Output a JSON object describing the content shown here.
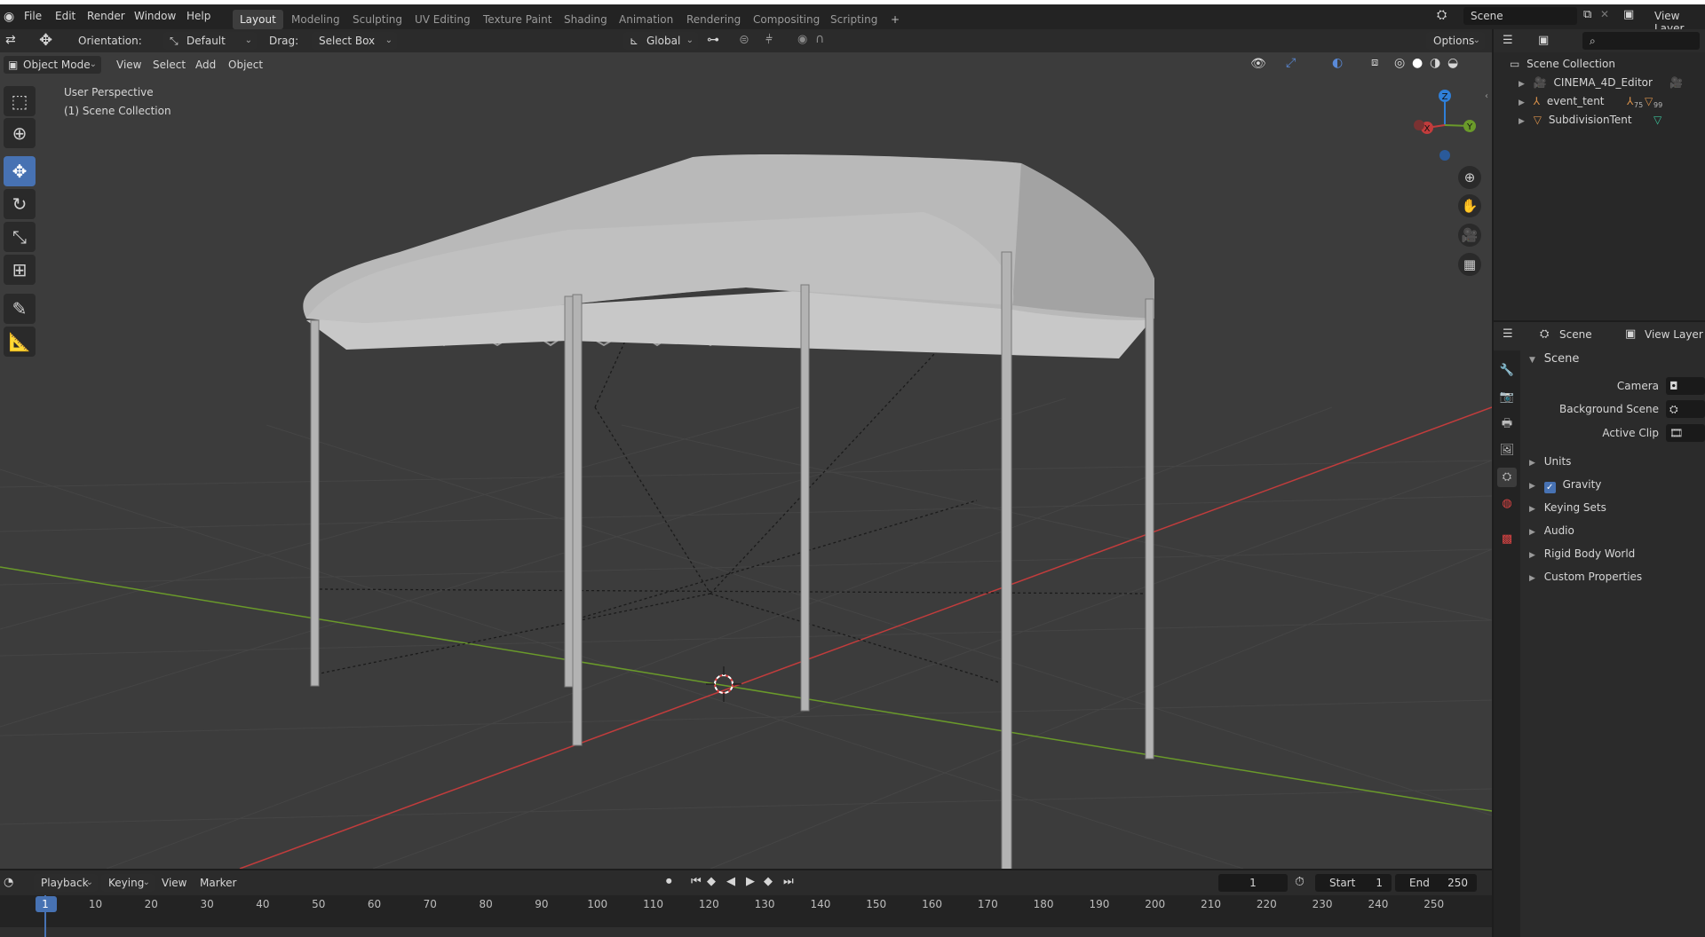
{
  "menu": {
    "items": [
      "File",
      "Edit",
      "Render",
      "Window",
      "Help"
    ]
  },
  "workspaces": {
    "tabs": [
      "Layout",
      "Modeling",
      "Sculpting",
      "UV Editing",
      "Texture Paint",
      "Shading",
      "Animation",
      "Rendering",
      "Compositing",
      "Scripting"
    ],
    "active": "Layout",
    "add_label": "+"
  },
  "topright": {
    "scene_field": "Scene",
    "view_layer_label": "View Layer"
  },
  "toolheader": {
    "orientation_label": "Orientation:",
    "orientation_value": "Default",
    "drag_label": "Drag:",
    "drag_value": "Select Box",
    "transform_value": "Global",
    "options_label": "Options"
  },
  "viewheader": {
    "mode": "Object Mode",
    "menus": [
      "View",
      "Select",
      "Add",
      "Object"
    ]
  },
  "viewport": {
    "perspective_label": "User Perspective",
    "collection_label": "(1) Scene Collection",
    "gizmo": {
      "x": "X",
      "y": "Y",
      "z": "Z"
    }
  },
  "outliner": {
    "root": "Scene Collection",
    "items": [
      {
        "label": "CINEMA_4D_Editor",
        "icon": "camera-icon"
      },
      {
        "label": "event_tent",
        "icon": "armature-icon",
        "badge_a": "75",
        "badge_b": "99"
      },
      {
        "label": "SubdivisionTent",
        "icon": "mesh-icon"
      }
    ]
  },
  "properties": {
    "tab_scene": "Scene",
    "tab_view_layer": "View Layer",
    "panel_title": "Scene",
    "fields": [
      {
        "label": "Camera"
      },
      {
        "label": "Background Scene"
      },
      {
        "label": "Active Clip"
      }
    ],
    "subpanels": [
      "Units",
      "Gravity",
      "Keying Sets",
      "Audio",
      "Rigid Body World",
      "Custom Properties"
    ],
    "gravity_checked": true
  },
  "timeline": {
    "menus": [
      "Playback",
      "Keying",
      "View",
      "Marker"
    ],
    "current_frame": "1",
    "start_label": "Start",
    "start_value": "1",
    "end_label": "End",
    "end_value": "250",
    "ticks": [
      "1",
      "10",
      "20",
      "30",
      "40",
      "50",
      "60",
      "70",
      "80",
      "90",
      "100",
      "110",
      "120",
      "130",
      "140",
      "150",
      "160",
      "170",
      "180",
      "190",
      "200",
      "210",
      "220",
      "230",
      "240",
      "250"
    ]
  },
  "colors": {
    "accent": "#4772b3",
    "x_axis": "#c23c3c",
    "y_axis": "#6a9a2a",
    "z_axis": "#2f7fd8"
  }
}
